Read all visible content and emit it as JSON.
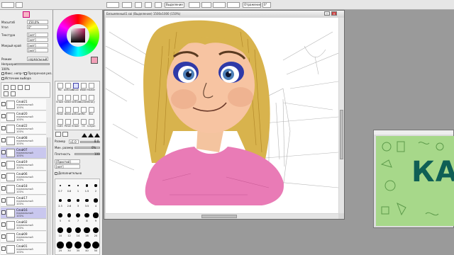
{
  "toolbar": {
    "items": [
      "",
      "",
      "",
      "",
      "",
      "",
      "",
      "Выделение",
      "",
      "",
      "",
      "",
      "Отражение",
      "0°"
    ]
  },
  "left": {
    "rows": [
      {
        "label": "Масштаб",
        "value": "150,0%"
      },
      {
        "label": "Угол",
        "value": "0°"
      },
      {
        "label": "Текстура",
        "value": "[нет]"
      },
      {
        "label": "",
        "value": "[нет]"
      },
      {
        "label": "Мокрый край",
        "value": "[нет]"
      },
      {
        "label": "",
        "value": "[нет]"
      },
      {
        "label": "Режим",
        "value": "нормальный"
      },
      {
        "label": "Непрозрачн.",
        "value": "100%"
      }
    ],
    "checks": [
      "Фикс. непр-ть",
      "Прозрачная рез.",
      "Источник выбора"
    ],
    "layers": [
      {
        "name": "Слой21",
        "mode": "нормальный",
        "op": "100%"
      },
      {
        "name": "Слой20",
        "mode": "нормальный",
        "op": "100%"
      },
      {
        "name": "Слой22",
        "mode": "нормальный",
        "op": "100%"
      },
      {
        "name": "Слой08",
        "mode": "нормальный",
        "op": "100%"
      },
      {
        "name": "Слой07",
        "mode": "нормальный",
        "op": "100%"
      },
      {
        "name": "Слой19",
        "mode": "нормальный",
        "op": "100%"
      },
      {
        "name": "Слой06",
        "mode": "нормальный",
        "op": "100%"
      },
      {
        "name": "Слой18",
        "mode": "нормальный",
        "op": "100%"
      },
      {
        "name": "Слой17",
        "mode": "нормальный",
        "op": "100%"
      },
      {
        "name": "Слой16",
        "mode": "нормальный",
        "op": "100%"
      },
      {
        "name": "Слой02",
        "mode": "нормальный",
        "op": "100%"
      },
      {
        "name": "Слой09",
        "mode": "нормальный",
        "op": "100%"
      },
      {
        "name": "Слой01",
        "mode": "нормальный",
        "op": "100%"
      }
    ]
  },
  "tools": {
    "cells": [
      "Pen",
      "AirBrush",
      "Brush",
      "Water",
      "Marker",
      "Eraser",
      "Select",
      "SelEras",
      "Bucket",
      "Binary",
      "Pencil",
      "Blend",
      "AirBrush",
      "Pen",
      "Blur",
      "Cloth",
      "Pencil",
      "Eraser",
      "Oil",
      "Crayon",
      "Wait",
      "Pen",
      "Dot",
      "Pen"
    ],
    "size_label": "Размер",
    "size_value": "x1.0",
    "size_num": "8.0",
    "min_size_label": "Мин. размер",
    "min_size_value": "0%",
    "density_label": "Плотность",
    "density_value": "100",
    "shape_value": "[Простой]",
    "texture_value": "[нет]",
    "extra_label": "Дополнительно",
    "size_grid": [
      "0.7",
      "0.8",
      "1",
      "1.5",
      "2",
      "2.3",
      "2.6",
      "3",
      "3.5",
      "4",
      "5",
      "6",
      "7",
      "8",
      "9",
      "10",
      "12",
      "14",
      "16",
      "20",
      "25",
      "30",
      "35",
      "40",
      "50"
    ]
  },
  "canvas": {
    "title": "Безымянный1.sai (Выделение) 1500x1000 (150%)",
    "close": "×"
  },
  "colors": {
    "fg": "#f2a0b8",
    "panel": "#ececec",
    "selected_layer": "#c9c7ee"
  },
  "preview": {
    "text": "КА"
  }
}
